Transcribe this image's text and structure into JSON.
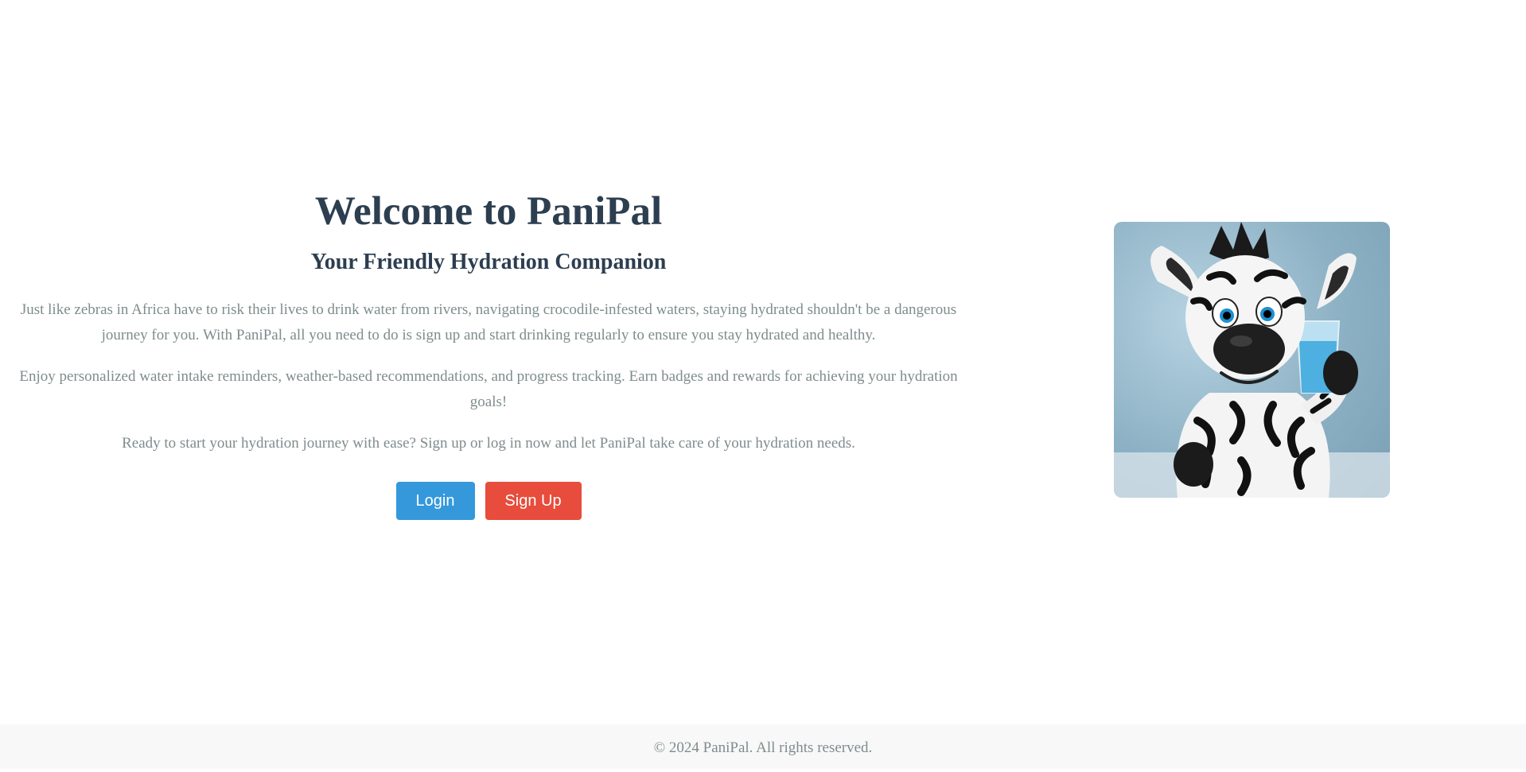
{
  "hero": {
    "title": "Welcome to PaniPal",
    "subtitle": "Your Friendly Hydration Companion",
    "paragraphs": [
      "Just like zebras in Africa have to risk their lives to drink water from rivers, navigating crocodile-infested waters, staying hydrated shouldn't be a dangerous journey for you. With PaniPal, all you need to do is sign up and start drinking regularly to ensure you stay hydrated and healthy.",
      "Enjoy personalized water intake reminders, weather-based recommendations, and progress tracking. Earn badges and rewards for achieving your hydration goals!",
      "Ready to start your hydration journey with ease? Sign up or log in now and let PaniPal take care of your hydration needs."
    ]
  },
  "buttons": {
    "login_label": "Login",
    "signup_label": "Sign Up"
  },
  "mascot": {
    "description_icon": "zebra-mascot-holding-water-glass"
  },
  "footer": {
    "text": "© 2024 PaniPal. All rights reserved."
  },
  "colors": {
    "heading": "#2c3e50",
    "body_text": "#7f8c8d",
    "login_button": "#3498db",
    "signup_button": "#e74c3c",
    "footer_bg": "#f8f8f8"
  }
}
